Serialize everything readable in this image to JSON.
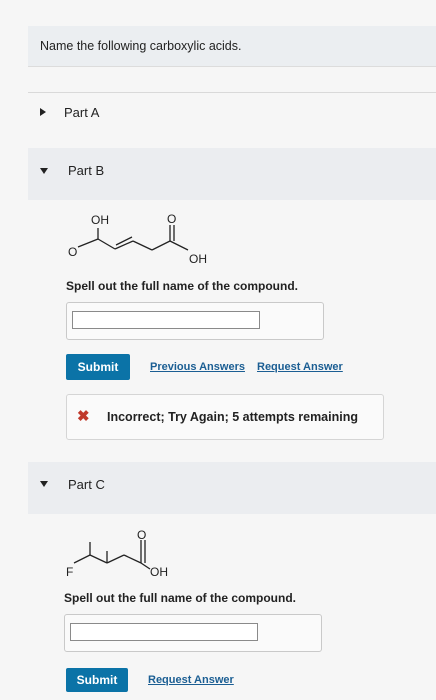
{
  "prompt": "Name the following carboxylic acids.",
  "parts": {
    "a": {
      "label": "Part A"
    },
    "b": {
      "label": "Part B",
      "structure": {
        "oh_label": "OH",
        "o_label": "O",
        "o_left_label": "O",
        "oh_right_label": "OH"
      },
      "question": "Spell out the full name of the compound.",
      "input_value": "",
      "submit_label": "Submit",
      "previous_answers_label": "Previous Answers",
      "request_answer_label": "Request Answer",
      "feedback": "Incorrect; Try Again; 5 attempts remaining"
    },
    "c": {
      "label": "Part C",
      "structure": {
        "o_label": "O",
        "f_label": "F",
        "oh_label": "OH"
      },
      "question": "Spell out the full name of the compound.",
      "input_value": "",
      "submit_label": "Submit",
      "request_answer_label": "Request Answer"
    }
  },
  "icons": {
    "feedback_icon": "x-icon"
  },
  "colors": {
    "submit": "#0b73a7",
    "link": "#1b5e93",
    "error": "#c0392b"
  }
}
